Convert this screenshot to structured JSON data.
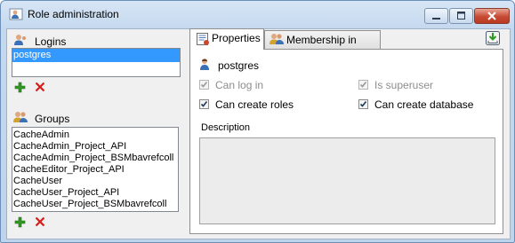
{
  "window": {
    "title": "Role administration",
    "icon": "user-icon"
  },
  "logins": {
    "label": "Logins",
    "items": [
      "postgres"
    ],
    "selected": 0
  },
  "groups": {
    "label": "Groups",
    "items": [
      "CacheAdmin",
      "CacheAdmin_Project_API",
      "CacheAdmin_Project_BSMbavrefcoll",
      "CacheEditor_Project_API",
      "CacheUser",
      "CacheUser_Project_API",
      "CacheUser_Project_BSMbavrefcoll"
    ]
  },
  "tabs": [
    {
      "label": "Properties",
      "active": true
    },
    {
      "label": "Membership in groups",
      "active": false
    }
  ],
  "properties": {
    "role_name": "postgres",
    "can_log_in": {
      "label": "Can log in",
      "checked": true,
      "enabled": false
    },
    "is_superuser": {
      "label": "Is superuser",
      "checked": true,
      "enabled": false
    },
    "can_create_roles": {
      "label": "Can create roles",
      "checked": true,
      "enabled": true
    },
    "can_create_database": {
      "label": "Can create database",
      "checked": true,
      "enabled": true
    },
    "description_label": "Description",
    "description_value": ""
  },
  "colors": {
    "selection": "#3399ff",
    "add": "#2e9b1e",
    "delete": "#d61b1b"
  }
}
